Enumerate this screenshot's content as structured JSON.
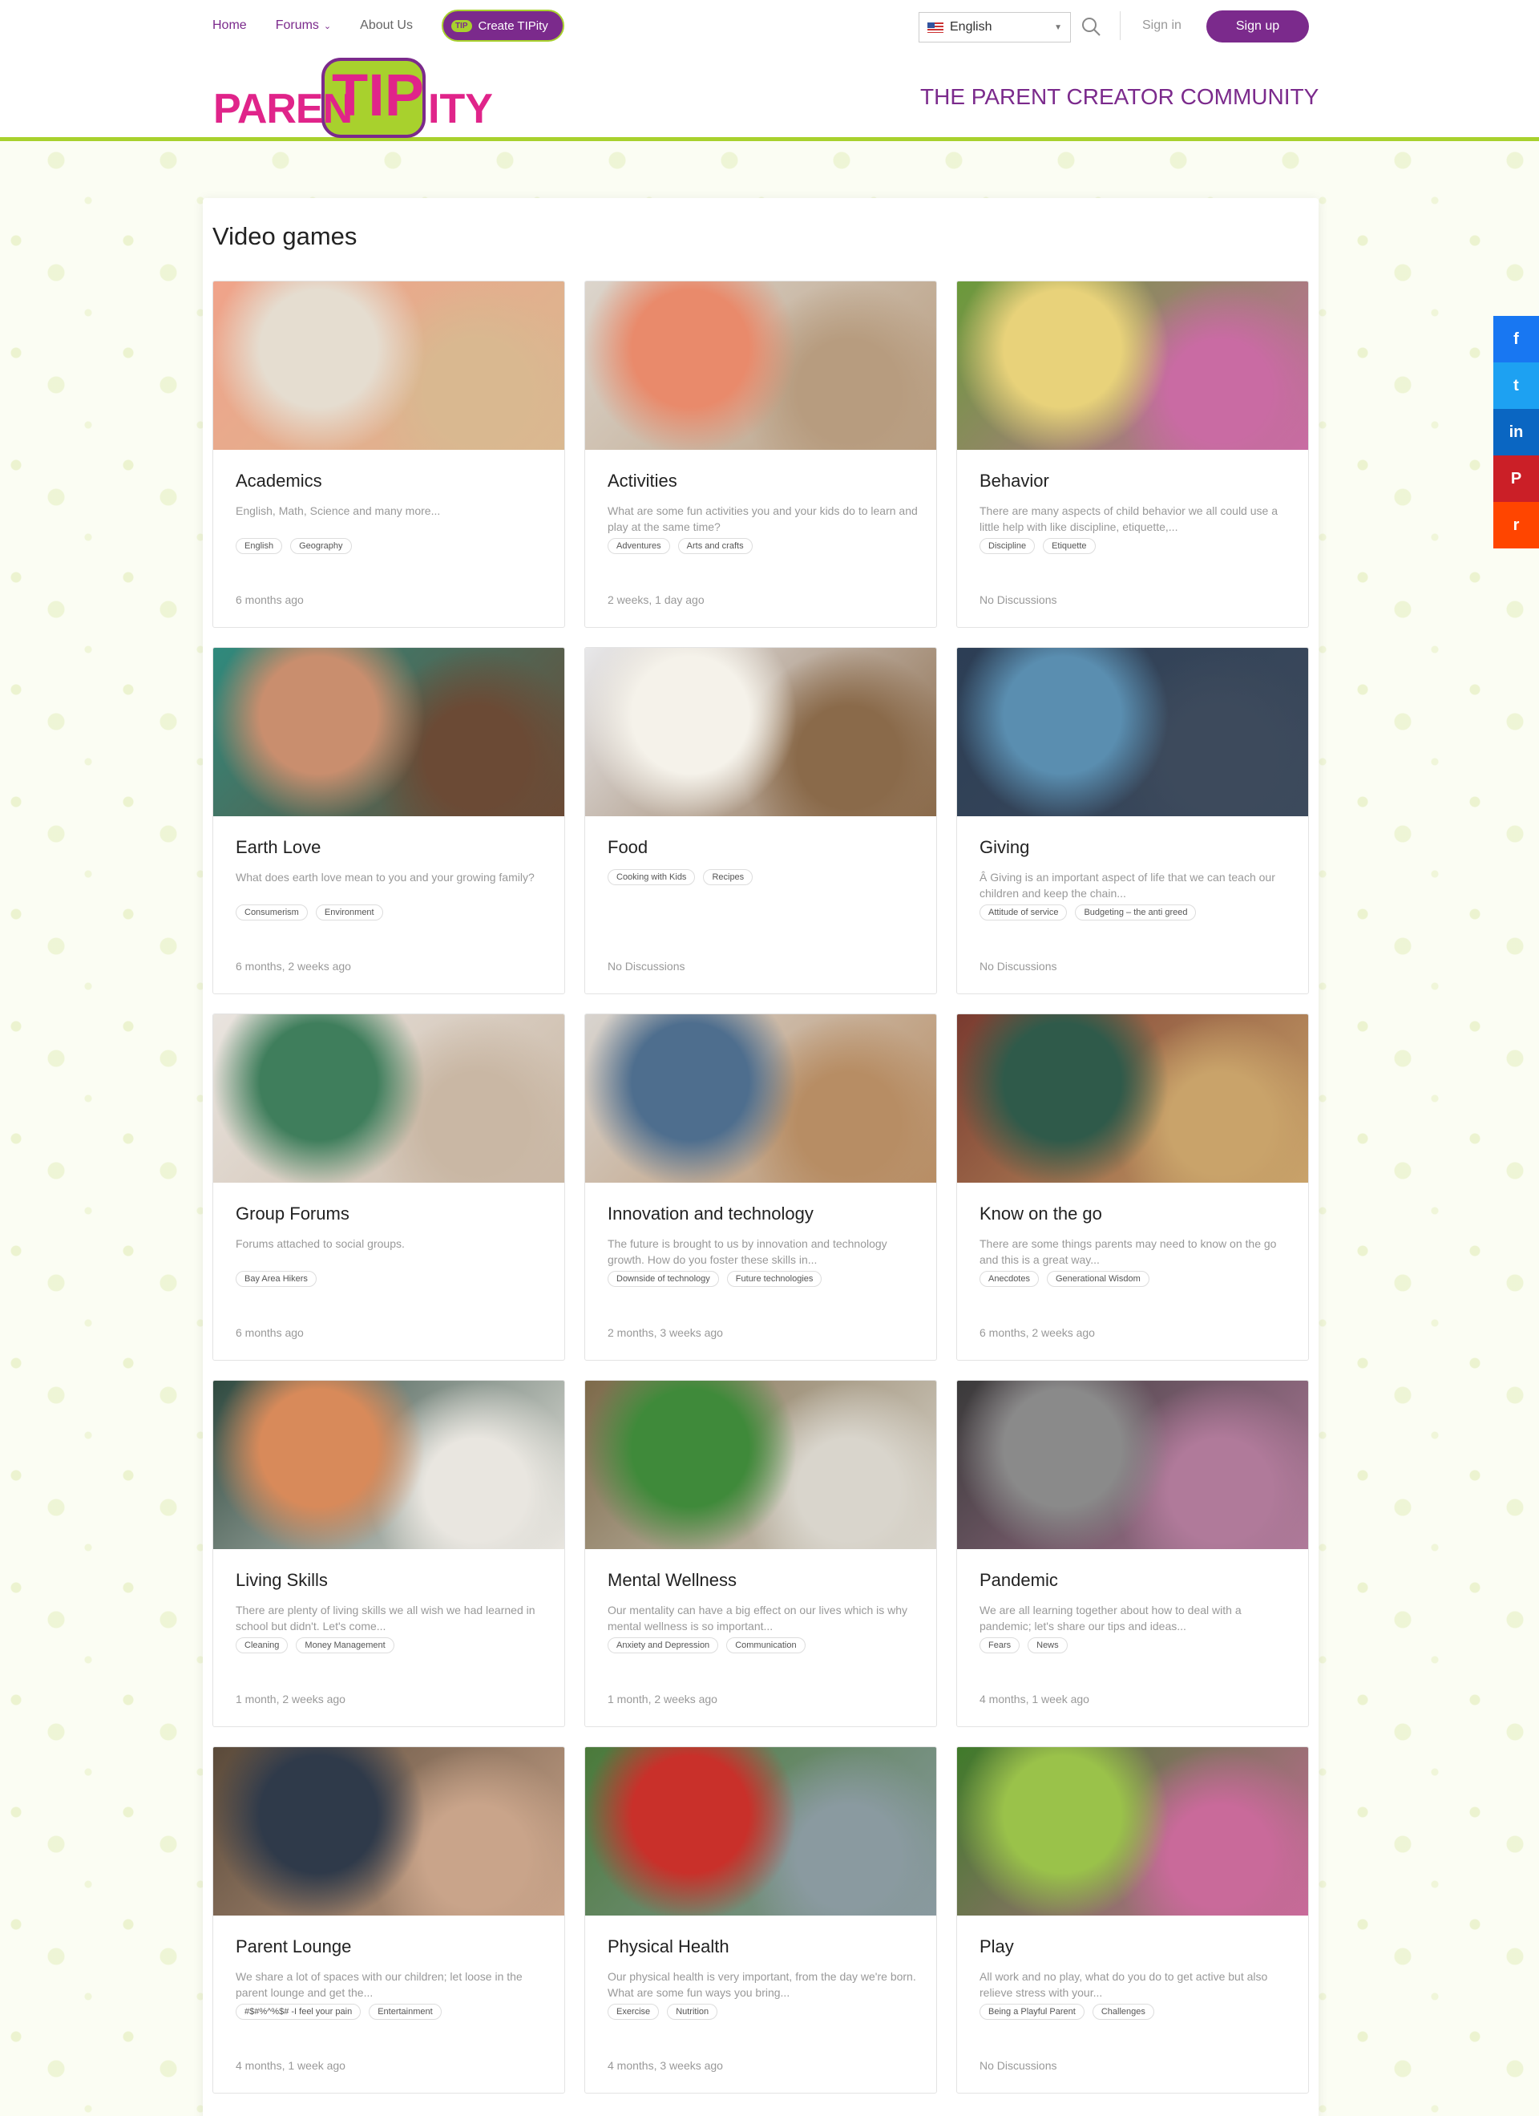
{
  "nav": {
    "home": "Home",
    "forums": "Forums",
    "about": "About Us",
    "create_badge": "TIP",
    "create": "Create TIPity"
  },
  "language": {
    "selected": "English"
  },
  "auth": {
    "signin": "Sign in",
    "signup": "Sign up"
  },
  "logo": {
    "left": "PAREN",
    "tip": "TIP",
    "right": "ITY"
  },
  "tagline": "THE PARENT CREATOR COMMUNITY",
  "page_title": "Video games",
  "colors": {
    "brand_purple": "#7b2a8c",
    "brand_green": "#a8d12d",
    "brand_pink": "#e0248a"
  },
  "cards": [
    {
      "title": "Academics",
      "desc": "English, Math, Science and many more...",
      "tags": [
        "English",
        "Geography"
      ],
      "meta": "6 months ago",
      "img": [
        "#f0a38a",
        "#e5ddd0",
        "#d9b890"
      ]
    },
    {
      "title": "Activities",
      "desc": "What are some fun activities you and your kids do to learn and play at the same time?",
      "tags": [
        "Adventures",
        "Arts and crafts"
      ],
      "meta": "2 weeks, 1 day ago",
      "img": [
        "#dcd5cc",
        "#e98a6b",
        "#b79c7f"
      ]
    },
    {
      "title": "Behavior",
      "desc": "There are many aspects of child behavior we all could use a little help with like discipline, etiquette,...",
      "tags": [
        "Discipline",
        "Etiquette"
      ],
      "meta": "No Discussions",
      "img": [
        "#6a9a3a",
        "#e8d27a",
        "#c96ba3"
      ]
    },
    {
      "title": "Earth Love",
      "desc": "What does earth love mean to you and your growing family?",
      "tags": [
        "Consumerism",
        "Environment"
      ],
      "meta": "6 months, 2 weeks ago",
      "img": [
        "#2f8a7d",
        "#c98e6e",
        "#6b4a35"
      ]
    },
    {
      "title": "Food",
      "desc": "",
      "tags": [
        "Cooking with Kids",
        "Recipes"
      ],
      "meta": "No Discussions",
      "img": [
        "#e8e8ea",
        "#f5f2ea",
        "#8a6a4a"
      ]
    },
    {
      "title": "Giving",
      "desc": "Â  Giving is an important aspect of life that we can teach our children and keep the chain...",
      "tags": [
        "Attitude of service",
        "Budgeting – the anti greed"
      ],
      "meta": "No Discussions",
      "img": [
        "#2c3e55",
        "#5a8eb0",
        "#3d4a5c"
      ]
    },
    {
      "title": "Group Forums",
      "desc": "Forums attached to social groups.",
      "tags": [
        "Bay Area Hikers"
      ],
      "meta": "6 months ago",
      "img": [
        "#e9e4df",
        "#3f7e5c",
        "#c9b7a4"
      ]
    },
    {
      "title": "Innovation and technology",
      "desc": "The future is brought to us by innovation and technology growth. How do you foster these skills in...",
      "tags": [
        "Downside of technology",
        "Future technologies"
      ],
      "meta": "2 months, 3 weeks ago",
      "img": [
        "#d8d4cf",
        "#4e6e8e",
        "#b78d64"
      ]
    },
    {
      "title": "Know on the go",
      "desc": "There are some things parents may need to know on the go and this is a great way...",
      "tags": [
        "Anecdotes",
        "Generational Wisdom"
      ],
      "meta": "6 months, 2 weeks ago",
      "img": [
        "#7a3b30",
        "#2f5a4a",
        "#c9a36a"
      ]
    },
    {
      "title": "Living Skills",
      "desc": "There are plenty of living skills we all wish we had learned in school but didn't. Let's come...",
      "tags": [
        "Cleaning",
        "Money Management"
      ],
      "meta": "1 month, 2 weeks ago",
      "img": [
        "#2f4a40",
        "#d88a5a",
        "#e9e6e0"
      ]
    },
    {
      "title": "Mental Wellness",
      "desc": "Our mentality can have a big effect on our lives which is why mental wellness is so important...",
      "tags": [
        "Anxiety and Depression",
        "Communication"
      ],
      "meta": "1 month, 2 weeks ago",
      "img": [
        "#7d6a4a",
        "#3f8a3a",
        "#d9d5cc"
      ]
    },
    {
      "title": "Pandemic",
      "desc": "We are all learning together about how to deal with a pandemic; let's share our tips and ideas...",
      "tags": [
        "Fears",
        "News"
      ],
      "meta": "4 months, 1 week ago",
      "img": [
        "#3a3a3a",
        "#8a8a8a",
        "#b07a9a"
      ]
    },
    {
      "title": "Parent Lounge",
      "desc": "We share a lot of spaces with our children; let loose in the parent lounge and get the...",
      "tags": [
        "#$#%^%$# -I feel your pain",
        "Entertainment"
      ],
      "meta": "4 months, 1 week ago",
      "img": [
        "#5a4a3a",
        "#2f3a4a",
        "#c9a48a"
      ]
    },
    {
      "title": "Physical Health",
      "desc": "Our physical health is very important, from the day we're born. What are some fun ways you bring...",
      "tags": [
        "Exercise",
        "Nutrition"
      ],
      "meta": "4 months, 3 weeks ago",
      "img": [
        "#4a7a3a",
        "#c9302a",
        "#8a9aa0"
      ]
    },
    {
      "title": "Play",
      "desc": "All work and no play, what do you do to get active but also relieve stress with your...",
      "tags": [
        "Being a Playful Parent",
        "Challenges"
      ],
      "meta": "No Discussions",
      "img": [
        "#3f7a2a",
        "#9ac24a",
        "#c96a9a"
      ]
    }
  ],
  "share": [
    {
      "icon": "facebook-icon",
      "glyph": "f",
      "color": "#1877f2"
    },
    {
      "icon": "twitter-icon",
      "glyph": "t",
      "color": "#1da1f2"
    },
    {
      "icon": "linkedin-icon",
      "glyph": "in",
      "color": "#0a66c2"
    },
    {
      "icon": "pinterest-icon",
      "glyph": "P",
      "color": "#cb1f27"
    },
    {
      "icon": "reddit-icon",
      "glyph": "r",
      "color": "#ff4500"
    }
  ]
}
